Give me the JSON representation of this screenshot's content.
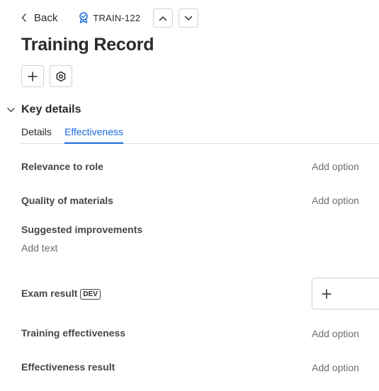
{
  "header": {
    "back_label": "Back",
    "issue_key": "TRAIN-122"
  },
  "page": {
    "title": "Training Record"
  },
  "section": {
    "title": "Key details",
    "tabs": [
      {
        "label": "Details",
        "active": false
      },
      {
        "label": "Effectiveness",
        "active": true
      }
    ]
  },
  "fields": {
    "relevance": {
      "label": "Relevance to role",
      "value": "Add option"
    },
    "quality": {
      "label": "Quality of materials",
      "value": "Add option"
    },
    "improvements": {
      "label": "Suggested improvements",
      "value": "Add text"
    },
    "exam": {
      "label": "Exam result",
      "badge": "DEV"
    },
    "training_effectiveness": {
      "label": "Training effectiveness",
      "value": "Add option"
    },
    "effectiveness_result": {
      "label": "Effectiveness result",
      "value": "Add option"
    }
  },
  "colors": {
    "accent": "#1868db",
    "text": "#292a2e",
    "muted": "#6b6e76",
    "border": "#d0d2d6"
  }
}
